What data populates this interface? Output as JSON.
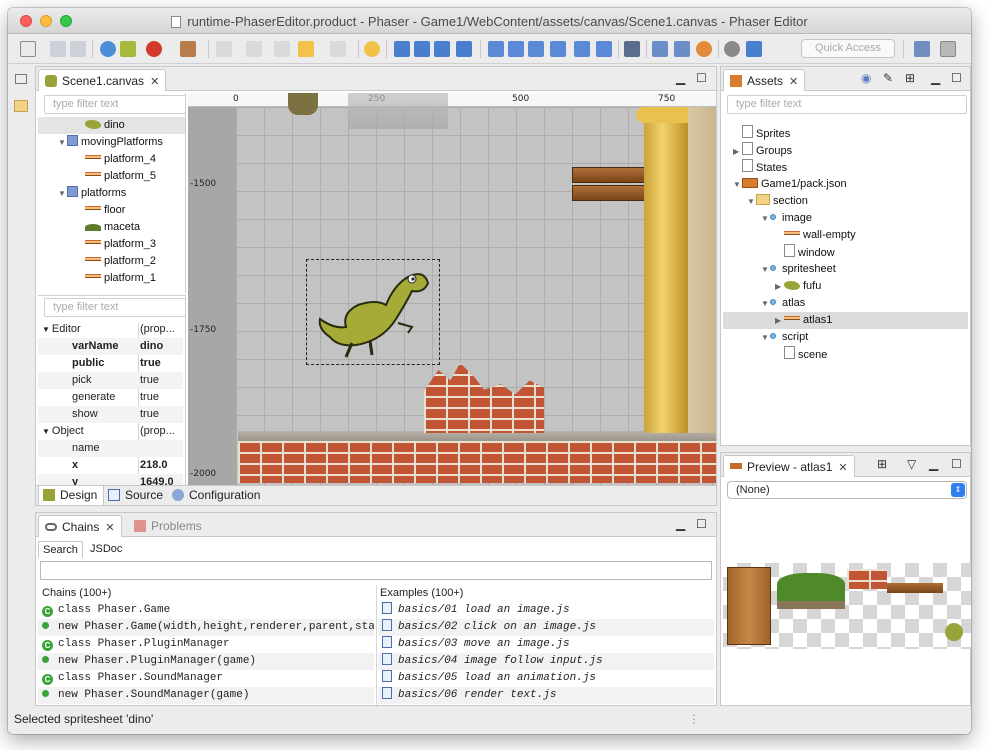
{
  "window": {
    "title": "runtime-PhaserEditor.product - Phaser - Game1/WebContent/assets/canvas/Scene1.canvas - Phaser Editor"
  },
  "toolbar": {
    "quick_access_placeholder": "Quick Access"
  },
  "editor": {
    "tab_label": "Scene1.canvas",
    "outline_filter_placeholder": "type filter text",
    "outline": [
      {
        "label": "dino",
        "icon": "dino-icon",
        "depth": 1,
        "toggle": ""
      },
      {
        "label": "movingPlatforms",
        "icon": "group-icon",
        "depth": 0,
        "toggle": "▼"
      },
      {
        "label": "platform_4",
        "icon": "platform-icon",
        "depth": 1,
        "toggle": ""
      },
      {
        "label": "platform_5",
        "icon": "platform-icon",
        "depth": 1,
        "toggle": ""
      },
      {
        "label": "platforms",
        "icon": "group-icon",
        "depth": 0,
        "toggle": "▼"
      },
      {
        "label": "floor",
        "icon": "platform-icon",
        "depth": 1,
        "toggle": ""
      },
      {
        "label": "maceta",
        "icon": "plant-icon",
        "depth": 1,
        "toggle": ""
      },
      {
        "label": "platform_3",
        "icon": "platform-icon",
        "depth": 1,
        "toggle": ""
      },
      {
        "label": "platform_2",
        "icon": "platform-icon",
        "depth": 1,
        "toggle": ""
      },
      {
        "label": "platform_1",
        "icon": "platform-icon",
        "depth": 1,
        "toggle": ""
      }
    ],
    "props_filter_placeholder": "type filter text",
    "properties": [
      {
        "key": "Editor",
        "value": "(prop...",
        "type": "cat"
      },
      {
        "key": "varName",
        "value": "dino",
        "type": "bold"
      },
      {
        "key": "public",
        "value": "true",
        "type": "bold"
      },
      {
        "key": "pick",
        "value": "true",
        "type": ""
      },
      {
        "key": "generate",
        "value": "true",
        "type": ""
      },
      {
        "key": "show",
        "value": "true",
        "type": ""
      },
      {
        "key": "Object",
        "value": "(prop...",
        "type": "cat"
      },
      {
        "key": "name",
        "value": "",
        "type": ""
      },
      {
        "key": "x",
        "value": "218.0",
        "type": "bold"
      },
      {
        "key": "y",
        "value": "1649.0",
        "type": "bold"
      }
    ],
    "ruler_top": [
      "0",
      "250",
      "500",
      "750"
    ],
    "ruler_left": [
      "-1500",
      "-1750",
      "-2000"
    ],
    "bottom_tabs": {
      "design": "Design",
      "source": "Source",
      "configuration": "Configuration"
    }
  },
  "assets": {
    "tab_label": "Assets",
    "filter_placeholder": "type filter text",
    "tree": [
      {
        "label": "Sprites",
        "icon": "file-icon",
        "depth": 0,
        "toggle": ""
      },
      {
        "label": "Groups",
        "icon": "file-icon",
        "depth": 0,
        "toggle": "▶"
      },
      {
        "label": "States",
        "icon": "file-icon",
        "depth": 0,
        "toggle": ""
      },
      {
        "label": "Game1/pack.json",
        "icon": "pack-icon",
        "depth": 0,
        "toggle": "▼"
      },
      {
        "label": "section",
        "icon": "folder-icon",
        "depth": 1,
        "toggle": "▼"
      },
      {
        "label": "image",
        "icon": "dot",
        "depth": 2,
        "toggle": "▼"
      },
      {
        "label": "wall-empty",
        "icon": "platform-icon",
        "depth": 3,
        "toggle": ""
      },
      {
        "label": "window",
        "icon": "file-icon",
        "depth": 3,
        "toggle": ""
      },
      {
        "label": "spritesheet",
        "icon": "dot",
        "depth": 2,
        "toggle": "▼"
      },
      {
        "label": "fufu",
        "icon": "dino-icon",
        "depth": 3,
        "toggle": "▶"
      },
      {
        "label": "atlas",
        "icon": "dot",
        "depth": 2,
        "toggle": "▼"
      },
      {
        "label": "atlas1",
        "icon": "platform-icon",
        "depth": 3,
        "toggle": "▶",
        "selected": true
      },
      {
        "label": "script",
        "icon": "dot",
        "depth": 2,
        "toggle": "▼"
      },
      {
        "label": "scene",
        "icon": "file-icon",
        "depth": 3,
        "toggle": ""
      }
    ]
  },
  "preview": {
    "tab_label": "Preview - atlas1",
    "select_value": "(None)"
  },
  "chains": {
    "tab_label": "Chains",
    "problems_label": "Problems",
    "subtabs": {
      "search": "Search",
      "jsdoc": "JSDoc"
    },
    "chains_header": "Chains (100+)",
    "examples_header": "Examples (100+)",
    "chain_items": [
      {
        "kind": "class",
        "text": "class Phaser.Game"
      },
      {
        "kind": "method",
        "text": "new Phaser.Game(width,height,renderer,parent,sta"
      },
      {
        "kind": "class",
        "text": "class Phaser.PluginManager"
      },
      {
        "kind": "method",
        "text": "new Phaser.PluginManager(game)"
      },
      {
        "kind": "class",
        "text": "class Phaser.SoundManager"
      },
      {
        "kind": "method",
        "text": "new Phaser.SoundManager(game)"
      }
    ],
    "example_items": [
      "basics/01 load an image.js",
      "basics/02 click on an image.js",
      "basics/03 move an image.js",
      "basics/04 image follow input.js",
      "basics/05 load an animation.js",
      "basics/06 render text.js"
    ]
  },
  "status": {
    "text": "Selected spritesheet 'dino'"
  }
}
